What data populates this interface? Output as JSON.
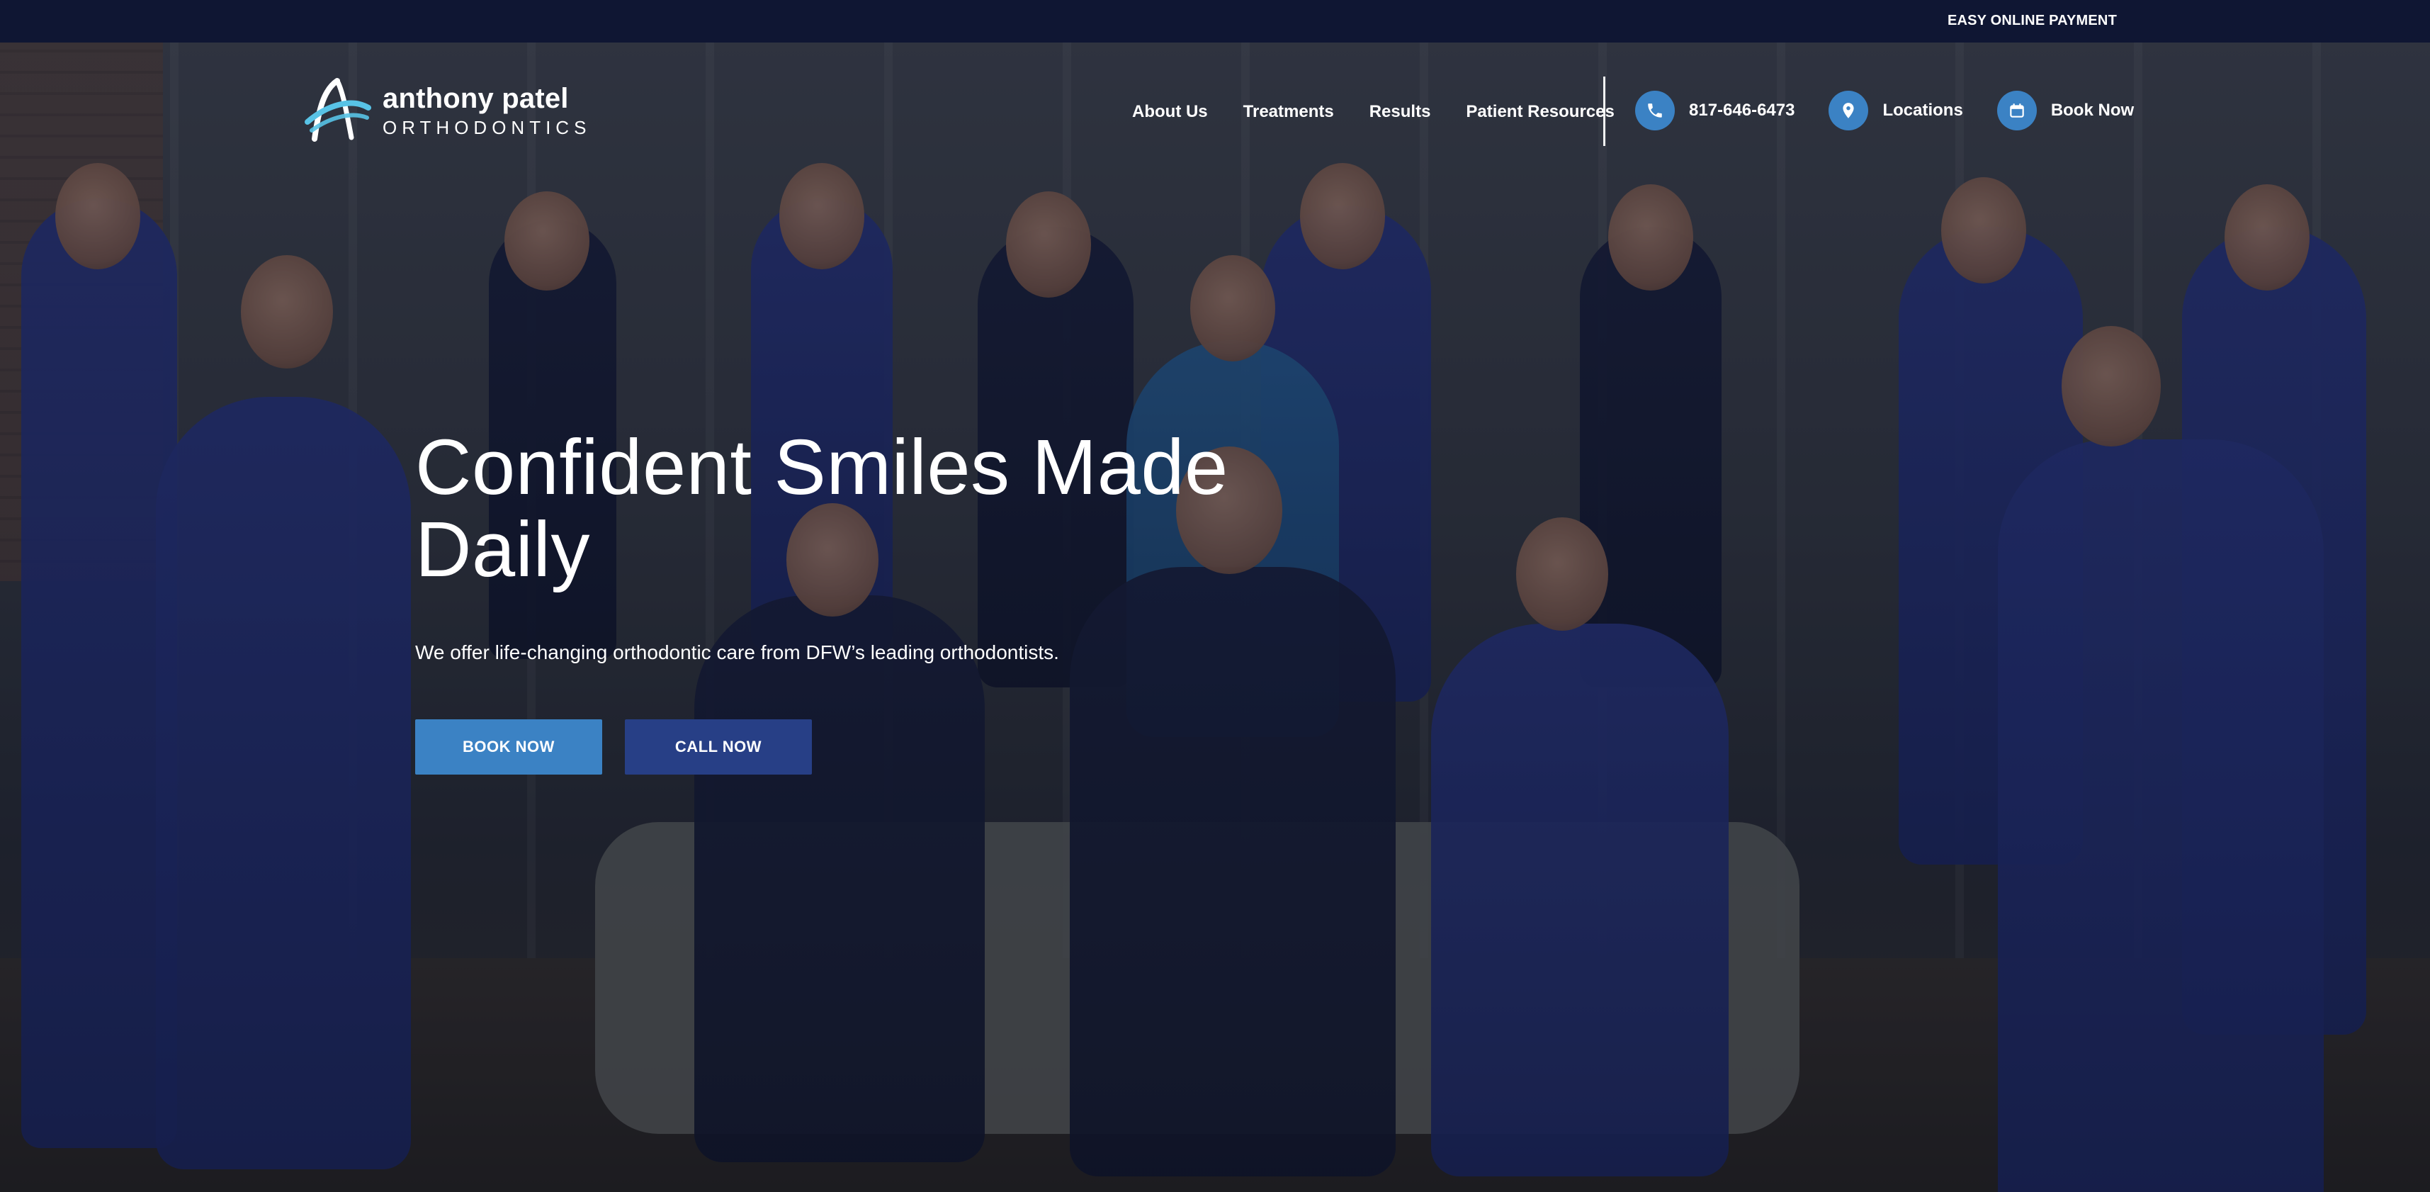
{
  "topbar": {
    "payment_link": "EASY ONLINE PAYMENT"
  },
  "header": {
    "logo": {
      "name": "anthony patel",
      "sub": "ORTHODONTICS"
    },
    "nav": [
      {
        "label": "About Us"
      },
      {
        "label": "Treatments"
      },
      {
        "label": "Results"
      },
      {
        "label": "Patient Resources"
      }
    ],
    "contact": {
      "phone": "817-646-6473",
      "locations": "Locations",
      "book_now": "Book Now"
    }
  },
  "hero": {
    "title_line1": "Confident Smiles Made",
    "title_line2": "Daily",
    "subtitle": "We offer life-changing orthodontic care from DFW’s leading orthodontists.",
    "buttons": {
      "book_now": "BOOK NOW",
      "call_now": "CALL NOW"
    }
  },
  "theme": {
    "topbar_bg": "#0f1633",
    "accent": "#3b82c4",
    "secondary": "#273f86",
    "text": "#ffffff"
  },
  "icons": {
    "phone": "phone-icon",
    "location": "map-pin-icon",
    "calendar": "calendar-icon"
  }
}
